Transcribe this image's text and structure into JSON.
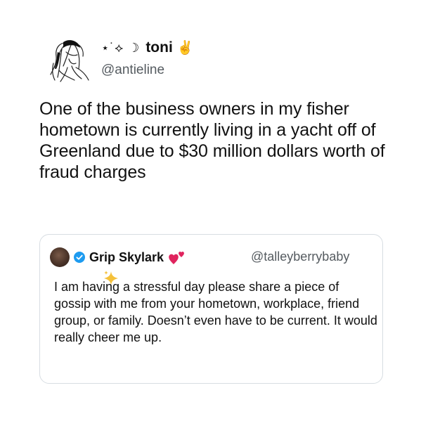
{
  "tweet": {
    "author": {
      "display_name": "toni",
      "name_prefix": "⋆˙⟡ ☽",
      "name_suffix": "✌",
      "handle": "@antieline",
      "avatar_icon": "sketch-portrait-avatar"
    },
    "text": "One of the business owners in my fisher hometown is currently living in a yacht off of Greenland due to $30 million dollars worth of fraud charges"
  },
  "quoted_tweet": {
    "author": {
      "display_name": "Grip Skylark",
      "handle": "@talleyberrybaby",
      "verified": true,
      "verified_color": "#1d9bf0",
      "name_emoji_icon": "two-hearts-icon"
    },
    "text": "I am having a stressful day please share a piece of gossip with me from your hometown, workplace, friend group, or family. Doesn’t even have to be current. It would really cheer me up."
  },
  "colors": {
    "background": "#ffffff",
    "text": "#111111",
    "secondary_text": "#555b60",
    "border": "#d7dde2",
    "heart": "#e0245e",
    "sparkle": "#f5c13b"
  }
}
